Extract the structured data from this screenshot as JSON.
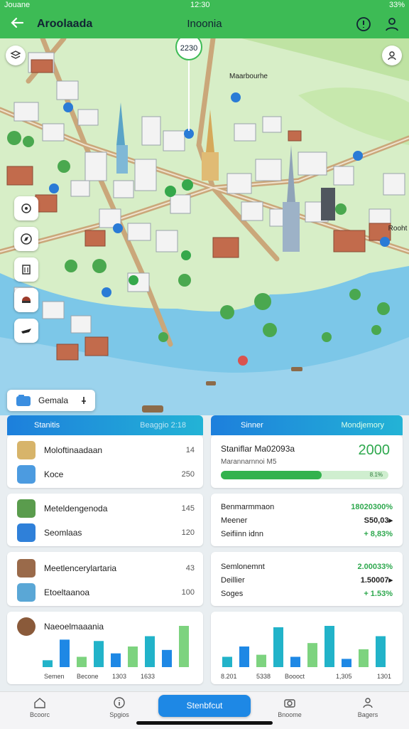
{
  "status_bar": {
    "left": "Jouane",
    "time": "12:30",
    "battery": "33%"
  },
  "header": {
    "app_title": "Aroolaada",
    "screen_title": "Inoonia"
  },
  "map": {
    "pin_label": "2230",
    "labels": {
      "harbor": "Maarbourhe",
      "district": "Rooht"
    }
  },
  "chip": {
    "label": "Gemala"
  },
  "panels": {
    "left_header": {
      "title": "Stanitis",
      "right": "Beaggio 2:18"
    },
    "right_header": {
      "title": "Sinner",
      "right": "Mondjemory"
    }
  },
  "list_cards": [
    {
      "title": "Moloftinaadaan",
      "title_value": "14",
      "sub": "Koce",
      "sub_value": "250"
    },
    {
      "title": "Meteldengenoda",
      "title_value": "145",
      "sub": "Seomlaas",
      "sub_value": "120"
    },
    {
      "title": "Meetlencerylartaria",
      "title_value": "43",
      "sub": "Etoeltaanoa",
      "sub_value": "100"
    },
    {
      "title": "Naeoelmaaania"
    }
  ],
  "stat_card": {
    "title": "Staniflar Ma02093a",
    "big_value": "2000",
    "progress_label": "Marannarnnoi M5",
    "progress": 0.6,
    "progress_tag": "8.1%"
  },
  "metric_cards": [
    {
      "rows": [
        {
          "label": "Benmarmmaon",
          "value": "18020300%",
          "color": "#2ea84e"
        },
        {
          "label": "Meener",
          "value": "S50,03▸",
          "color": "#222"
        },
        {
          "label": "Seifiinn idnn",
          "value": "+ 8,83%",
          "color": "#2ea84e"
        }
      ]
    },
    {
      "rows": [
        {
          "label": "Semlonemnt",
          "value": "2.00033%",
          "color": "#2ea84e"
        },
        {
          "label": "Deillier",
          "value": "1.50007▸",
          "color": "#222"
        },
        {
          "label": "Soges",
          "value": "+ 1.53%",
          "color": "#2ea84e"
        }
      ]
    }
  ],
  "bar_cards": {
    "left_captions": [
      "Semen",
      "Becone",
      "1303",
      "1633"
    ],
    "right_captions": [
      "8.201",
      "5338",
      "Boooct",
      "1,305",
      "1301"
    ]
  },
  "chart_data": [
    {
      "type": "bar",
      "series": [
        {
          "values": [
            1,
            4,
            1.5,
            3.8,
            2,
            3,
            4.5,
            2.5,
            6
          ]
        }
      ]
    },
    {
      "type": "bar",
      "series": [
        {
          "values": [
            1.5,
            3,
            1.8,
            5.8,
            1.5,
            3.5,
            6,
            1.2,
            2.6,
            4.5
          ]
        }
      ]
    }
  ],
  "colors": {
    "primary_green": "#3dbb55",
    "primary_blue": "#1e88e5",
    "teal": "#22b3c9",
    "bar_green": "#7dd37f"
  },
  "bottom_nav": [
    {
      "label": "Bcoorc",
      "icon": "home-icon"
    },
    {
      "label": "Spgios",
      "icon": "info-icon"
    },
    {
      "label": "Stenbfcut",
      "icon": "primary-action"
    },
    {
      "label": "Bnoome",
      "icon": "camera-icon"
    },
    {
      "label": "Bagers",
      "icon": "profile-icon"
    }
  ]
}
